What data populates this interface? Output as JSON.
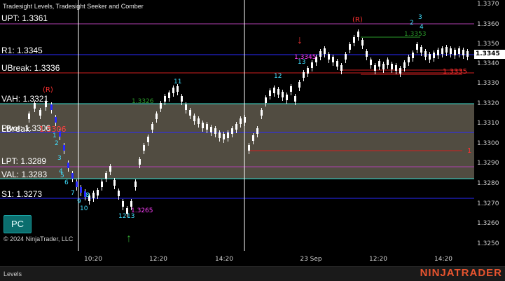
{
  "chart": {
    "title": "Tradesight Levels, Tradesight Seeker and Comber",
    "copyright": "© 2024 NinjaTrader, LLC",
    "pc_button": "PC",
    "footer_tab": "Levels",
    "brand": "NINJATRADER",
    "last_price": "1.3345",
    "red_price_tag": "1.3335",
    "red_marker": "1"
  },
  "price_axis": {
    "ticks": [
      "1.3370",
      "1.3360",
      "1.3350",
      "1.3340",
      "1.3330",
      "1.3320",
      "1.3310",
      "1.3300",
      "1.3290",
      "1.3280",
      "1.3270",
      "1.3260",
      "1.3250"
    ],
    "range": [
      1.3248,
      1.3372
    ]
  },
  "time_axis": {
    "ticks": [
      "10:20",
      "12:20",
      "14:20",
      "23 Sep",
      "12:20",
      "14:20"
    ]
  },
  "levels": [
    {
      "label": "UPT: 1.3361",
      "price": 1.3361,
      "color": "#b040b0"
    },
    {
      "label": "R1: 1.3345",
      "price": 1.3345,
      "color": "#2a2aff"
    },
    {
      "label": "UBreak: 1.3336",
      "price": 1.3336,
      "color": "#d02020"
    },
    {
      "label": "VAH: 1.3321",
      "price": 1.3321,
      "color": "#40e0d0"
    },
    {
      "label": "Pivot: 1.3306",
      "price": 1.3306,
      "color": "#2a2aff"
    },
    {
      "label": "LPT: 1.3289",
      "price": 1.3289,
      "color": "#b040b0"
    },
    {
      "label": "VAL: 1.3283",
      "price": 1.3283,
      "color": "#40e0d0"
    },
    {
      "label": "S1: 1.3273",
      "price": 1.3273,
      "color": "#2a2aff"
    }
  ],
  "overlay_labels": {
    "pivot_overlap": "LBreak",
    "pivot_overlap_red": "1.3306",
    "r_marker": "(R)",
    "low_price": "1.3265",
    "hi_tag_1": "1.3345",
    "annot_1": "1.3326",
    "annot_2": "1.3353"
  },
  "annotations": [
    {
      "text": "12",
      "color": "#40e0ff"
    },
    {
      "text": "13",
      "color": "#40e0ff"
    },
    {
      "text": "10",
      "color": "#40e0ff"
    },
    {
      "text": "11",
      "color": "#40e0ff"
    },
    {
      "text": "9",
      "color": "#40e0ff"
    },
    {
      "text": "8",
      "color": "#40e0ff"
    },
    {
      "text": "7",
      "color": "#40e0ff"
    },
    {
      "text": "6",
      "color": "#40e0ff"
    },
    {
      "text": "5",
      "color": "#40e0ff"
    },
    {
      "text": "4",
      "color": "#40e0ff"
    },
    {
      "text": "3",
      "color": "#40e0ff"
    },
    {
      "text": "2",
      "color": "#40e0ff"
    },
    {
      "text": "1",
      "color": "#40e0ff"
    },
    {
      "text": "12",
      "color": "#40e0ff"
    },
    {
      "text": "13",
      "color": "#40e0ff"
    },
    {
      "text": "2",
      "color": "#40e0ff"
    },
    {
      "text": "3",
      "color": "#40e0ff"
    },
    {
      "text": "4",
      "color": "#40e0ff"
    }
  ]
}
